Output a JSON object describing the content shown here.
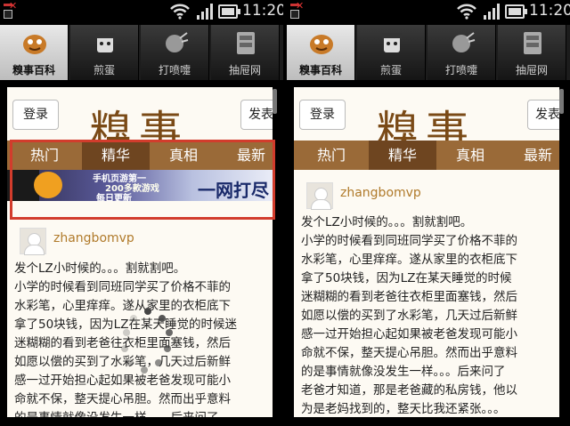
{
  "status_bar": {
    "time": "11:20"
  },
  "tabs": [
    {
      "label": "糗事百科",
      "icon": "qiushi-icon"
    },
    {
      "label": "煎蛋",
      "icon": "jiandan-icon"
    },
    {
      "label": "打喷嚏",
      "icon": "sneeze-icon"
    },
    {
      "label": "抽屉网",
      "icon": "drawer-icon"
    }
  ],
  "header": {
    "login_label": "登录",
    "post_label": "发表",
    "logo_text": "糗事"
  },
  "categories": [
    "热门",
    "精华",
    "真相",
    "最新"
  ],
  "active_category": "精华",
  "ad": {
    "line1": "手机页游第一",
    "line2": "200多款游戏",
    "line3": "每日更新",
    "line4": "一网打尽"
  },
  "post": {
    "username": "zhangbomvp",
    "lines_left": [
      "发个LZ小时候的。。。割就割吧。",
      "小学的时候看到同班同学买了价格不菲的",
      "水彩笔，心里痒痒。遂从家里的衣柜底下",
      "拿了50块钱，因为LZ在某天睡觉的时候迷",
      "迷糊糊的看到老爸往衣柜里面塞钱，然后",
      "如愿以偿的买到了水彩笔，几天过后新鲜",
      "感一过开始担心起如果被老爸发现可能小",
      "命就不保，整天提心吊胆。然而出乎意料",
      "的是事情就像没发生一样。。。后来问了"
    ],
    "lines_right": [
      "发个LZ小时候的。。。割就割吧。",
      "小学的时候看到同班同学买了价格不菲的",
      "水彩笔，心里痒痒。遂从家里的衣柜底下",
      "拿了50块钱，因为LZ在某天睡觉的时候",
      "迷糊糊的看到老爸往衣柜里面塞钱，然后",
      "如愿以偿的买到了水彩笔，几天过后新鲜",
      "感一过开始担心起如果被老爸发现可能小",
      "命就不保，整天提心吊胆。然而出乎意料",
      "的是事情就像没发生一样。。。后来问了",
      "老爸才知道，那是老爸藏的私房钱，他以",
      "为是老妈找到的，整天比我还紧张。。。"
    ]
  },
  "colors": {
    "category_bar": "#9a6a38",
    "category_active": "#6e4520",
    "username": "#b07a2a",
    "highlight": "#d23c2c",
    "content_bg": "#fdfaf3"
  }
}
